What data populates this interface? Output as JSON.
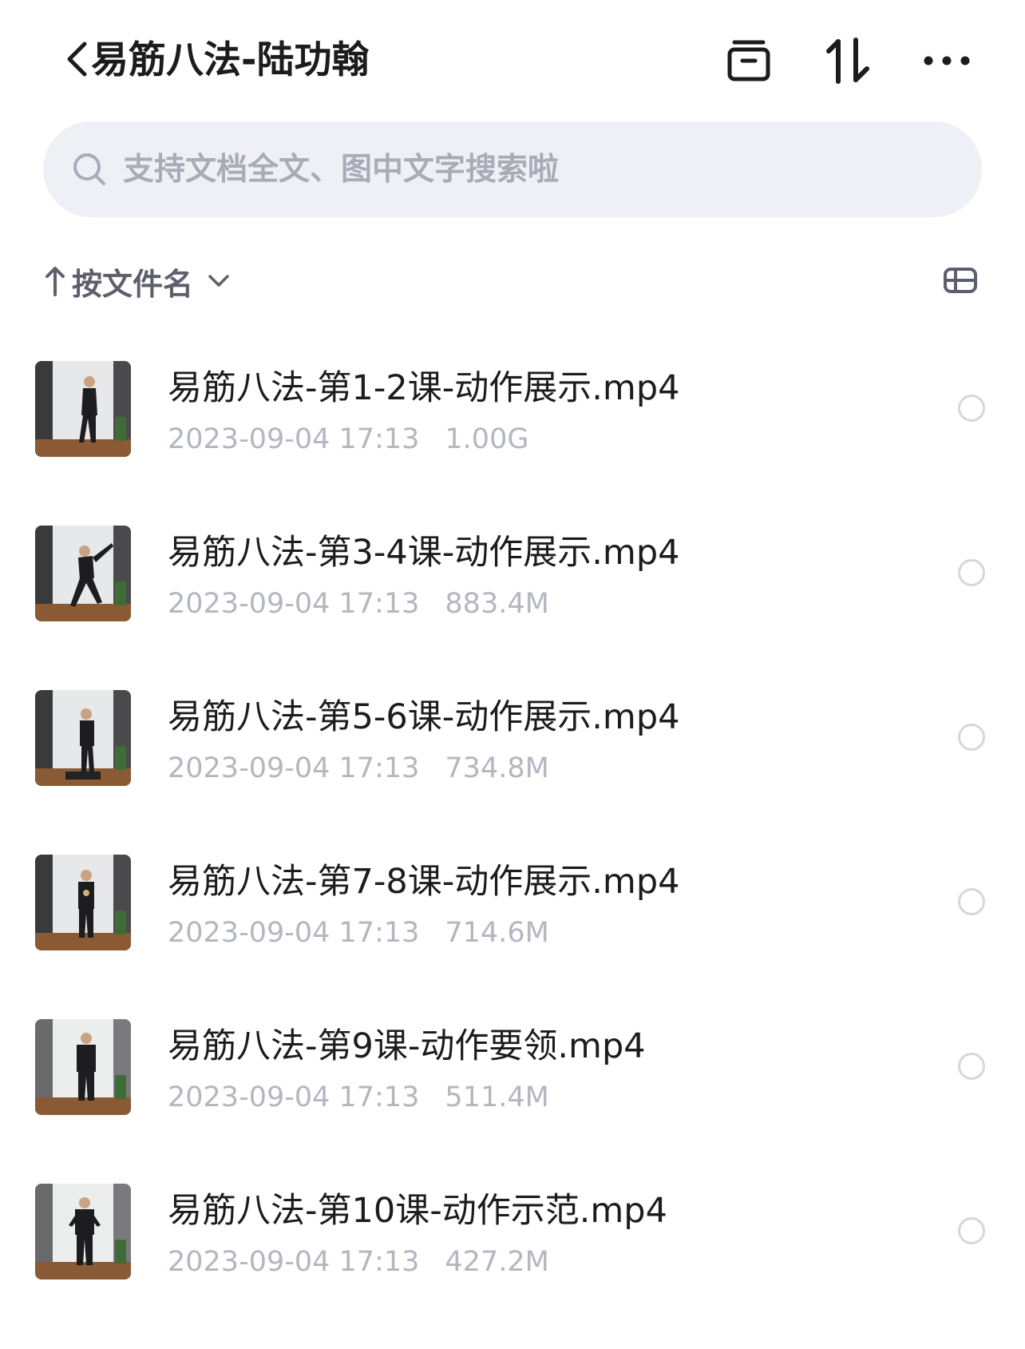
{
  "header": {
    "title": "易筋八法-陆功翰",
    "back_icon": "chevron-left-icon",
    "actions": [
      {
        "name": "archive-icon"
      },
      {
        "name": "sort-swap-icon"
      },
      {
        "name": "more-icon"
      }
    ]
  },
  "search": {
    "placeholder": "支持文档全文、图中文字搜索啦",
    "value": "",
    "icon": "search-icon"
  },
  "sort": {
    "label": "按文件名",
    "direction_icon": "arrow-up-icon",
    "dropdown_icon": "chevron-down-icon",
    "view_toggle_icon": "list-view-icon"
  },
  "files": [
    {
      "name": "易筋八法-第1-2课-动作展示.mp4",
      "date": "2023-09-04 17:13",
      "size": "1.00G",
      "selected": false
    },
    {
      "name": "易筋八法-第3-4课-动作展示.mp4",
      "date": "2023-09-04 17:13",
      "size": "883.4M",
      "selected": false
    },
    {
      "name": "易筋八法-第5-6课-动作展示.mp4",
      "date": "2023-09-04 17:13",
      "size": "734.8M",
      "selected": false
    },
    {
      "name": "易筋八法-第7-8课-动作展示.mp4",
      "date": "2023-09-04 17:13",
      "size": "714.6M",
      "selected": false
    },
    {
      "name": "易筋八法-第9课-动作要领.mp4",
      "date": "2023-09-04 17:13",
      "size": "511.4M",
      "selected": false
    },
    {
      "name": "易筋八法-第10课-动作示范.mp4",
      "date": "2023-09-04 17:13",
      "size": "427.2M",
      "selected": false
    }
  ],
  "colors": {
    "background": "#ffffff",
    "search_bg": "#eff0f6",
    "title_text": "#1c1c1e",
    "meta_text": "#b4b6c0",
    "placeholder_text": "#a9abb7",
    "radio_border": "#d6d7dd"
  }
}
